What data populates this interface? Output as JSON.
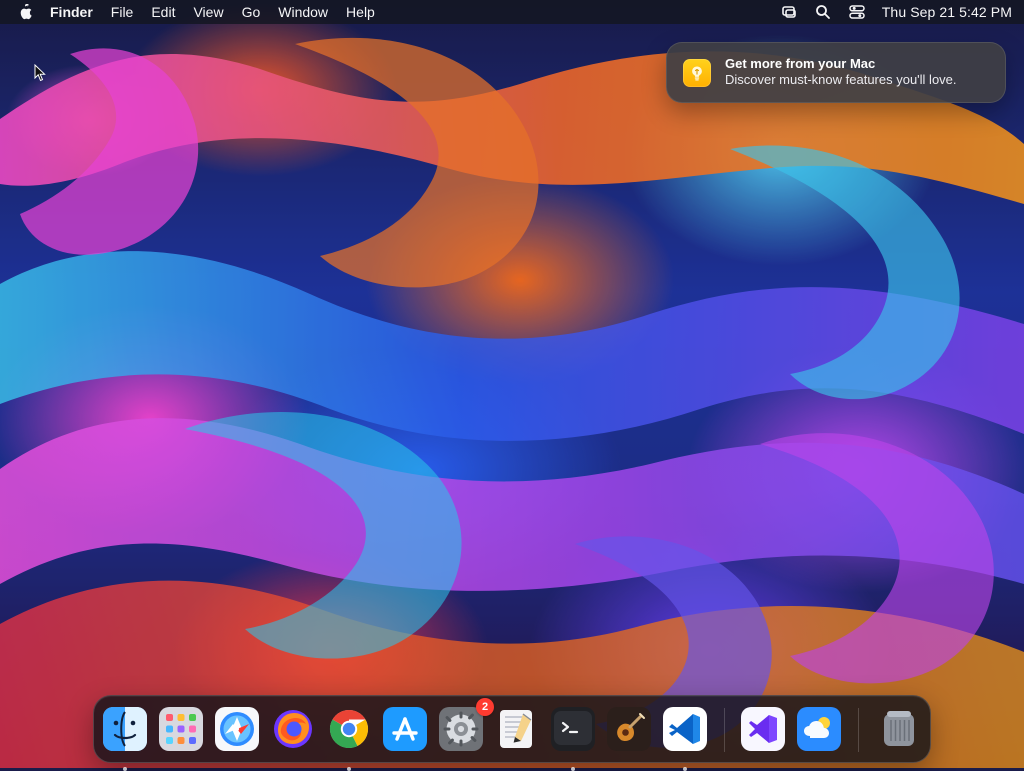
{
  "menubar": {
    "app_name": "Finder",
    "items": [
      "File",
      "Edit",
      "View",
      "Go",
      "Window",
      "Help"
    ],
    "status": {
      "icons": [
        "screen-mirroring-icon",
        "search-icon",
        "control-center-icon"
      ],
      "clock": "Thu Sep 21  5:42 PM"
    }
  },
  "notification": {
    "title": "Get more from your Mac",
    "body": "Discover must-know features you'll love.",
    "icon": "tips-lightbulb-icon",
    "colors": {
      "icon_background": "#ffbf00",
      "panel": "#3f3f44"
    }
  },
  "dock": {
    "apps": [
      {
        "name": "finder",
        "icon": "finder-icon",
        "running": true
      },
      {
        "name": "launchpad",
        "icon": "launchpad-icon",
        "running": false
      },
      {
        "name": "safari",
        "icon": "safari-icon",
        "running": false
      },
      {
        "name": "firefox",
        "icon": "firefox-icon",
        "running": false
      },
      {
        "name": "chrome",
        "icon": "chrome-icon",
        "running": true
      },
      {
        "name": "app-store",
        "icon": "app-store-icon",
        "running": false
      },
      {
        "name": "system-settings",
        "icon": "gear-icon",
        "running": false,
        "badge": "2"
      },
      {
        "name": "textedit",
        "icon": "textedit-icon",
        "running": false
      },
      {
        "name": "terminal",
        "icon": "terminal-icon",
        "running": true
      },
      {
        "name": "garageband",
        "icon": "guitar-icon",
        "running": false
      },
      {
        "name": "visual-studio-code",
        "icon": "vscode-icon",
        "running": true
      },
      {
        "name": "visual-studio",
        "icon": "visual-studio-icon",
        "running": false
      },
      {
        "name": "weather",
        "icon": "weather-icon",
        "running": false
      },
      {
        "name": "trash",
        "icon": "trash-icon",
        "running": false
      }
    ],
    "colors": {
      "running_dot": "#d9d9df",
      "badge": "#ff3b30"
    }
  }
}
